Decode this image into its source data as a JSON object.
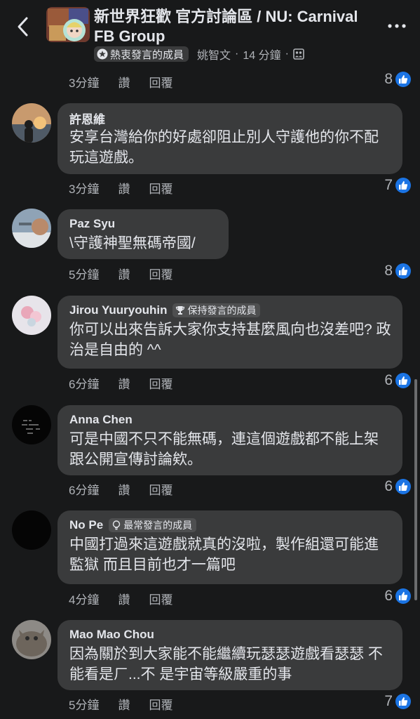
{
  "header": {
    "title": "新世界狂歡 官方討論區 / NU: Carnival FB Group",
    "badge_label": "熱衷發言的成員",
    "author": "姚智文",
    "time": "14 分鐘"
  },
  "first_meta": {
    "time": "3分鐘",
    "like": "讚",
    "reply": "回覆",
    "likes": "8"
  },
  "comments": [
    {
      "name": "許恩維",
      "badge": "",
      "text": "安享台灣給你的好處卻阻止別人守護他的你不配玩這遊戲。",
      "time": "3分鐘",
      "like": "讚",
      "reply": "回覆",
      "likes": "7"
    },
    {
      "name": "Paz Syu",
      "badge": "",
      "text": "\\守護神聖無碼帝國/",
      "time": "5分鐘",
      "like": "讚",
      "reply": "回覆",
      "likes": "8"
    },
    {
      "name": "Jirou Yuuryouhin",
      "badge": "保持發言的成員",
      "text": "你可以出來告訴大家你支持甚麼風向也沒差吧? 政治是自由的 ^^",
      "time": "6分鐘",
      "like": "讚",
      "reply": "回覆",
      "likes": "6"
    },
    {
      "name": "Anna Chen",
      "badge": "",
      "text": "可是中國不只不能無碼，連這個遊戲都不能上架跟公開宣傳討論欸。",
      "time": "6分鐘",
      "like": "讚",
      "reply": "回覆",
      "likes": "6"
    },
    {
      "name": "No Pe",
      "badge": "最常發言的成員",
      "text": "中國打過來這遊戲就真的沒啦，製作組還可能進監獄 而且目前也才一篇吧",
      "time": "4分鐘",
      "like": "讚",
      "reply": "回覆",
      "likes": "6"
    },
    {
      "name": "Mao Mao Chou",
      "badge": "",
      "text": "因為關於到大家能不能繼續玩瑟瑟遊戲看瑟瑟 不能看是ㄏ...不 是宇宙等級嚴重的事",
      "time": "5分鐘",
      "like": "讚",
      "reply": "回覆",
      "likes": "7"
    }
  ],
  "colors": {
    "background": "#18191a",
    "bubble": "#3a3b3c",
    "like_blue": "#1b74e4"
  }
}
